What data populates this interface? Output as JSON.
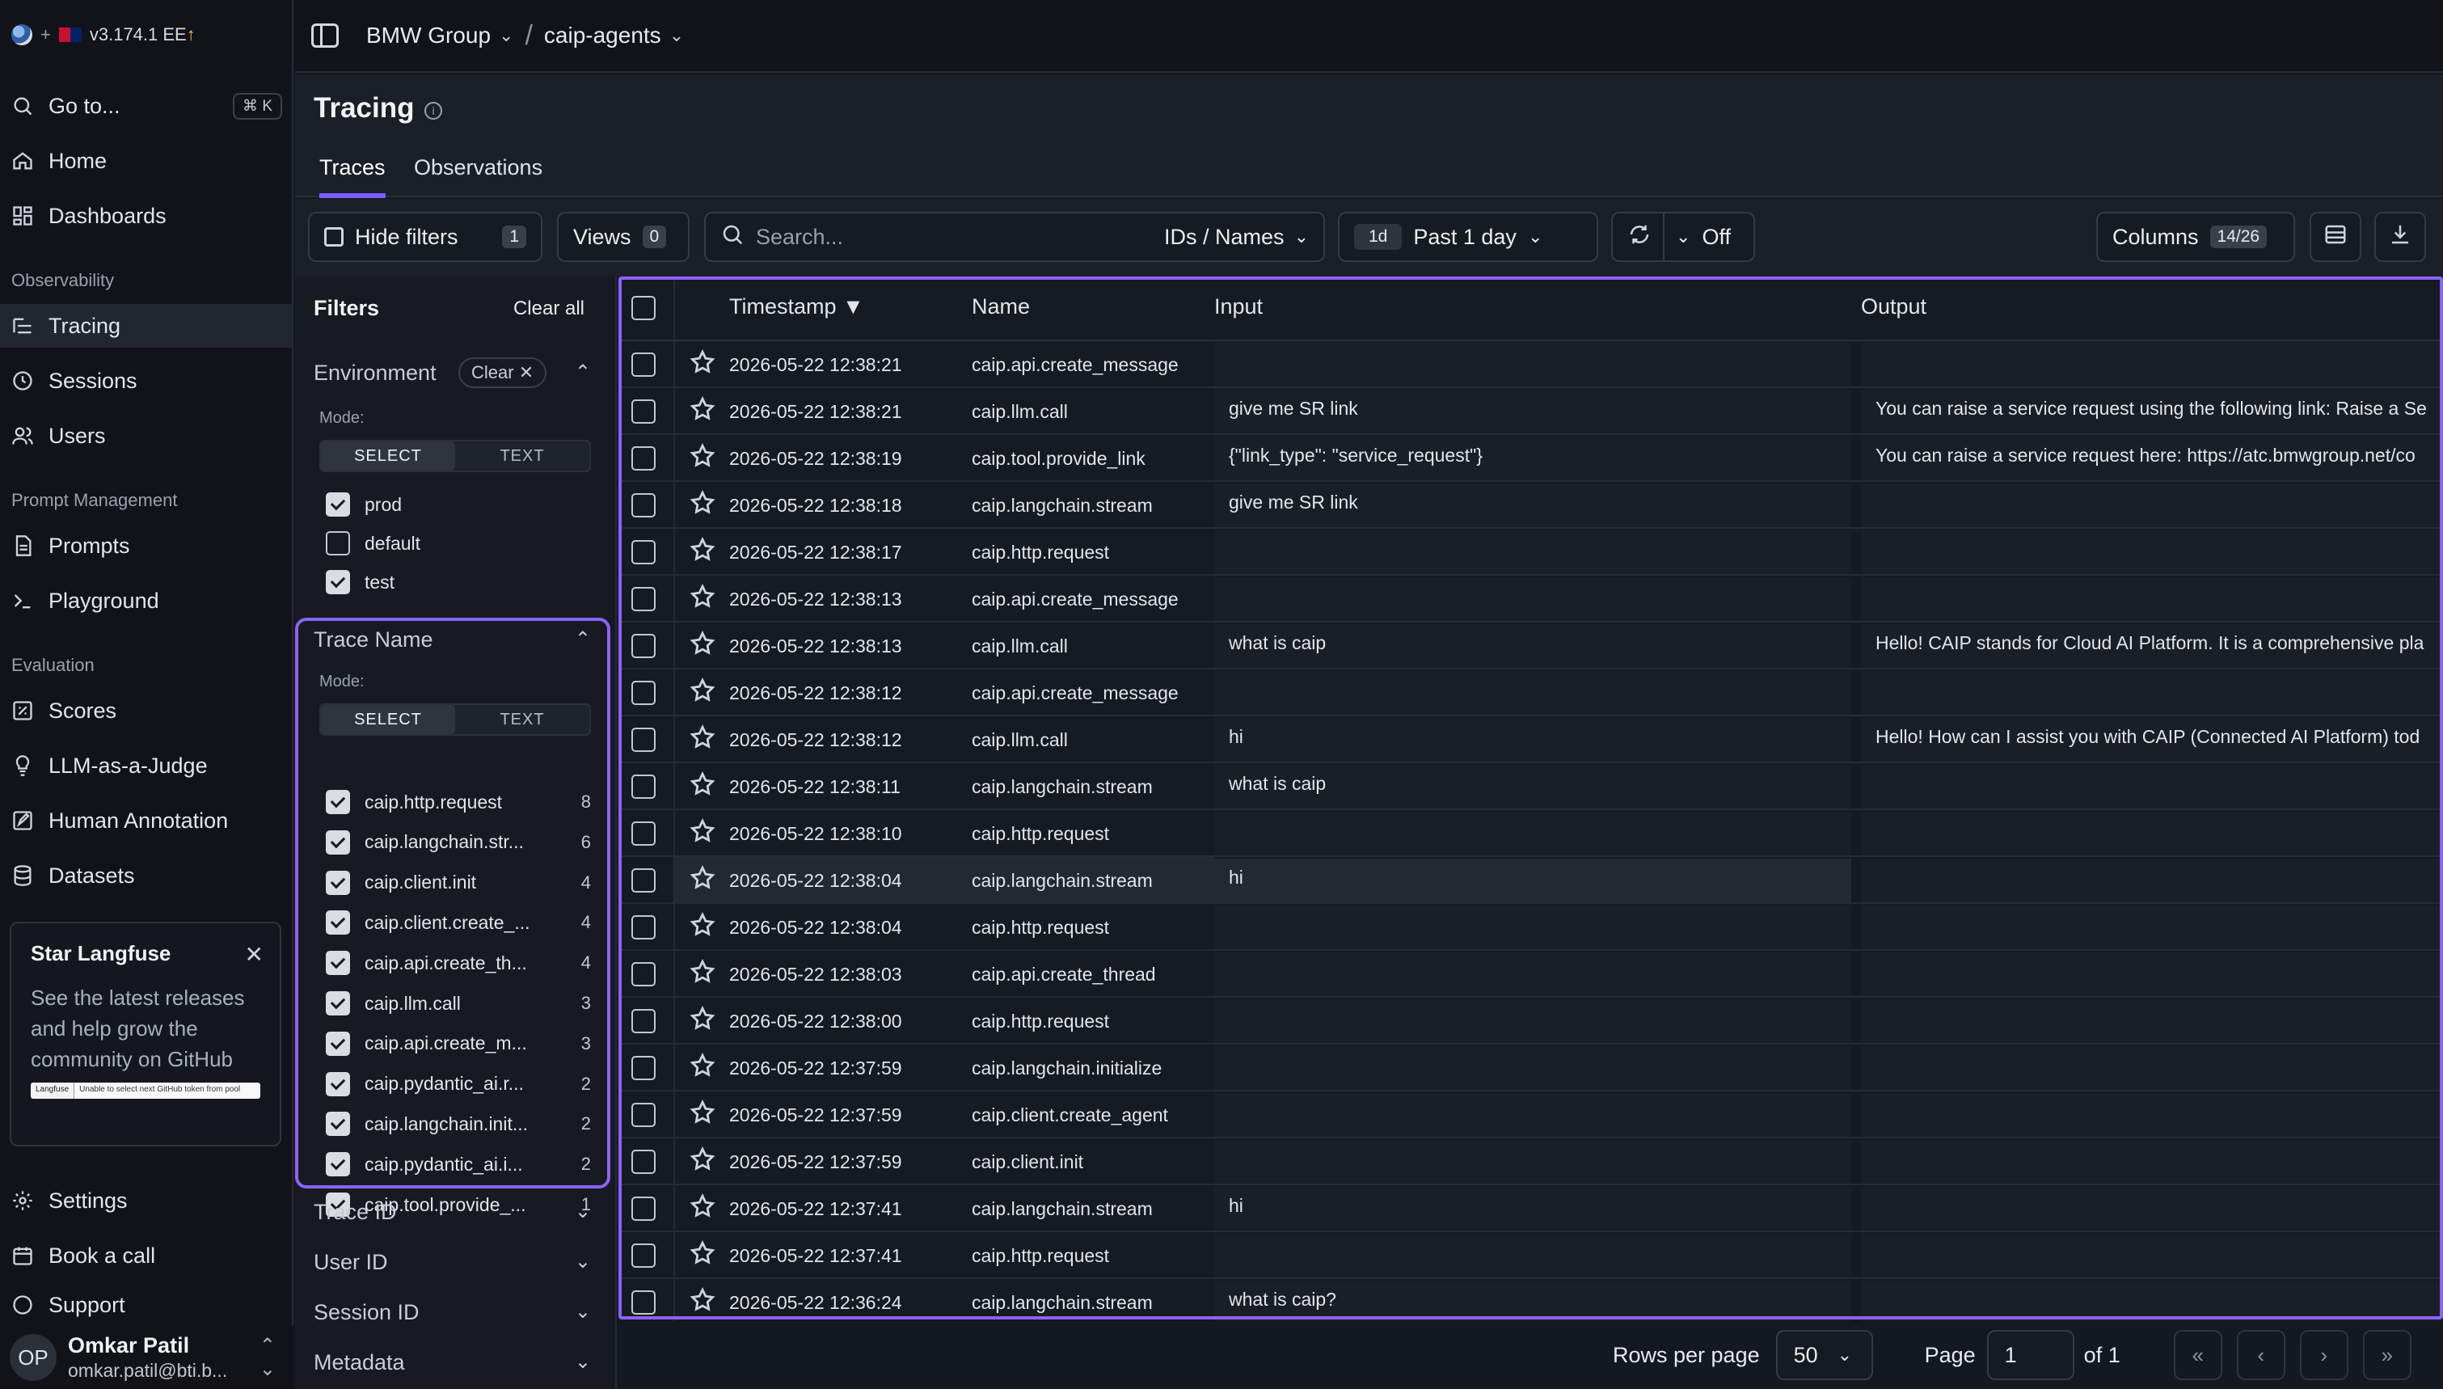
{
  "sidebar": {
    "version": "v3.174.1 EE",
    "plus": "+",
    "goto_label": "Go to...",
    "goto_shortcut": "⌘ K",
    "home": "Home",
    "dashboards": "Dashboards",
    "section_observability": "Observability",
    "tracing": "Tracing",
    "sessions": "Sessions",
    "users": "Users",
    "section_prompt": "Prompt Management",
    "prompts": "Prompts",
    "playground": "Playground",
    "section_evaluation": "Evaluation",
    "scores": "Scores",
    "llm_judge": "LLM-as-a-Judge",
    "human_annotation": "Human Annotation",
    "datasets": "Datasets",
    "star_card": {
      "title": "Star Langfuse",
      "body": "See the latest releases and help grow the community on GitHub",
      "badge_left": "Langfuse",
      "badge_right": "Unable to select next GitHub token from pool"
    },
    "settings": "Settings",
    "book_call": "Book a call",
    "support": "Support",
    "user": {
      "initials": "OP",
      "name": "Omkar Patil",
      "email": "omkar.patil@bti.b..."
    }
  },
  "header": {
    "org": "BMW Group",
    "project": "caip-agents"
  },
  "page": {
    "title": "Tracing",
    "tabs": [
      "Traces",
      "Observations"
    ],
    "active_tab": "Traces"
  },
  "toolbar": {
    "hide_filters": "Hide filters",
    "filter_count": "1",
    "views": "Views",
    "views_count": "0",
    "search_placeholder": "Search...",
    "search_scope": "IDs / Names",
    "range_short": "1d",
    "range_label": "Past 1 day",
    "refresh_label": "Off",
    "columns": "Columns",
    "columns_count": "14/26"
  },
  "filters": {
    "title": "Filters",
    "clear_all": "Clear all",
    "environment": {
      "label": "Environment",
      "chip": "Clear",
      "mode_label": "Mode:",
      "mode_select": "SELECT",
      "mode_text": "TEXT",
      "options": [
        {
          "label": "prod",
          "checked": true
        },
        {
          "label": "default",
          "checked": false
        },
        {
          "label": "test",
          "checked": true
        }
      ]
    },
    "trace_name": {
      "label": "Trace Name",
      "mode_label": "Mode:",
      "mode_select": "SELECT",
      "mode_text": "TEXT",
      "options": [
        {
          "label": "caip.http.request",
          "count": "8"
        },
        {
          "label": "caip.langchain.str...",
          "count": "6"
        },
        {
          "label": "caip.client.init",
          "count": "4"
        },
        {
          "label": "caip.client.create_...",
          "count": "4"
        },
        {
          "label": "caip.api.create_th...",
          "count": "4"
        },
        {
          "label": "caip.llm.call",
          "count": "3"
        },
        {
          "label": "caip.api.create_m...",
          "count": "3"
        },
        {
          "label": "caip.pydantic_ai.r...",
          "count": "2"
        },
        {
          "label": "caip.langchain.init...",
          "count": "2"
        },
        {
          "label": "caip.pydantic_ai.i...",
          "count": "2"
        },
        {
          "label": "caip.tool.provide_...",
          "count": "1"
        }
      ]
    },
    "collapsed": [
      "Trace ID",
      "User ID",
      "Session ID",
      "Metadata"
    ]
  },
  "table": {
    "columns": [
      "Timestamp ▼",
      "Name",
      "Input",
      "Output"
    ],
    "rows": [
      {
        "ts": "2026-05-22 12:38:21",
        "name": "caip.api.create_message",
        "input": "",
        "output": ""
      },
      {
        "ts": "2026-05-22 12:38:21",
        "name": "caip.llm.call",
        "input": "give me SR link",
        "output": "You can raise a service request using the following link: Raise a Se"
      },
      {
        "ts": "2026-05-22 12:38:19",
        "name": "caip.tool.provide_link",
        "input": "{\"link_type\": \"service_request\"}",
        "output": "You can raise a service request here: https://atc.bmwgroup.net/co"
      },
      {
        "ts": "2026-05-22 12:38:18",
        "name": "caip.langchain.stream",
        "input": "give me SR link",
        "output": ""
      },
      {
        "ts": "2026-05-22 12:38:17",
        "name": "caip.http.request",
        "input": "",
        "output": ""
      },
      {
        "ts": "2026-05-22 12:38:13",
        "name": "caip.api.create_message",
        "input": "",
        "output": ""
      },
      {
        "ts": "2026-05-22 12:38:13",
        "name": "caip.llm.call",
        "input": "what is caip",
        "output": "Hello! CAIP stands for Cloud AI Platform. It is a comprehensive pla"
      },
      {
        "ts": "2026-05-22 12:38:12",
        "name": "caip.api.create_message",
        "input": "",
        "output": ""
      },
      {
        "ts": "2026-05-22 12:38:12",
        "name": "caip.llm.call",
        "input": "hi",
        "output": "Hello! How can I assist you with CAIP (Connected AI Platform) tod"
      },
      {
        "ts": "2026-05-22 12:38:11",
        "name": "caip.langchain.stream",
        "input": "what is caip",
        "output": ""
      },
      {
        "ts": "2026-05-22 12:38:10",
        "name": "caip.http.request",
        "input": "",
        "output": ""
      },
      {
        "ts": "2026-05-22 12:38:04",
        "name": "caip.langchain.stream",
        "input": "hi",
        "output": ""
      },
      {
        "ts": "2026-05-22 12:38:04",
        "name": "caip.http.request",
        "input": "",
        "output": ""
      },
      {
        "ts": "2026-05-22 12:38:03",
        "name": "caip.api.create_thread",
        "input": "",
        "output": ""
      },
      {
        "ts": "2026-05-22 12:38:00",
        "name": "caip.http.request",
        "input": "",
        "output": ""
      },
      {
        "ts": "2026-05-22 12:37:59",
        "name": "caip.langchain.initialize",
        "input": "",
        "output": ""
      },
      {
        "ts": "2026-05-22 12:37:59",
        "name": "caip.client.create_agent",
        "input": "",
        "output": ""
      },
      {
        "ts": "2026-05-22 12:37:59",
        "name": "caip.client.init",
        "input": "",
        "output": ""
      },
      {
        "ts": "2026-05-22 12:37:41",
        "name": "caip.langchain.stream",
        "input": "hi",
        "output": ""
      },
      {
        "ts": "2026-05-22 12:37:41",
        "name": "caip.http.request",
        "input": "",
        "output": ""
      },
      {
        "ts": "2026-05-22 12:36:24",
        "name": "caip.langchain.stream",
        "input": "what is caip?",
        "output": ""
      }
    ]
  },
  "pagination": {
    "rows_per_page_label": "Rows per page",
    "rows_per_page": "50",
    "page_label": "Page",
    "page": "1",
    "of_label": "of 1"
  },
  "colors": {
    "accent": "#7c5cff",
    "highlight_border": "#8a63ff",
    "background": "#141820"
  }
}
